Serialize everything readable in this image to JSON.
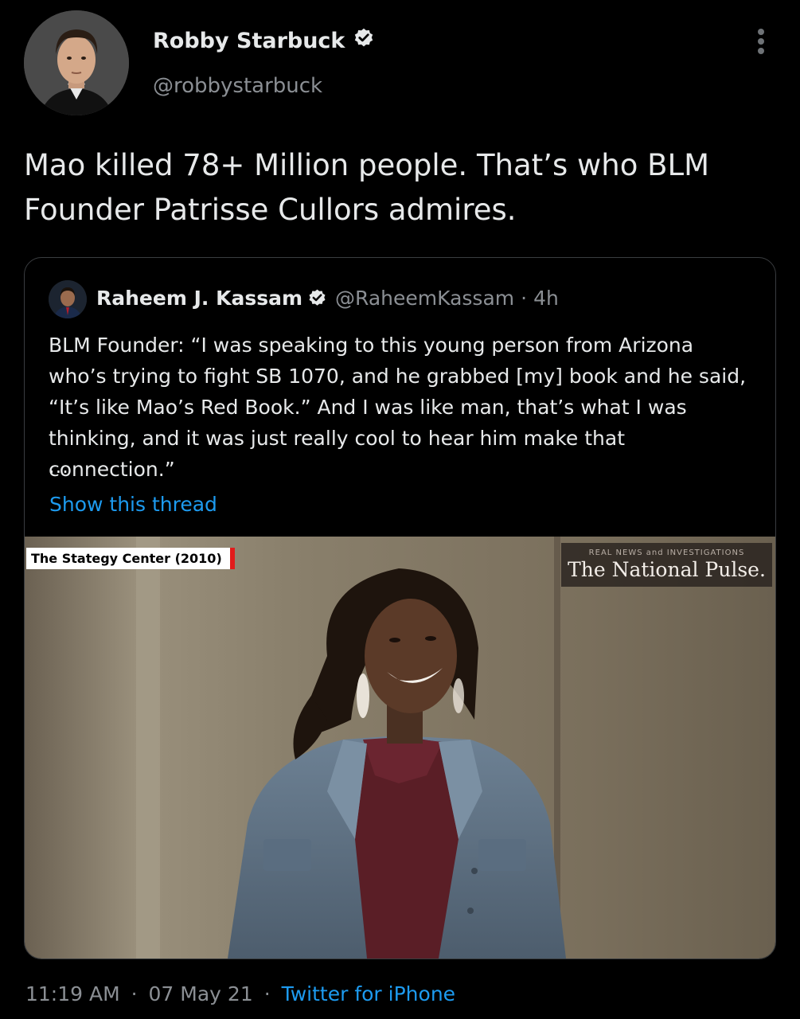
{
  "tweet": {
    "author": {
      "name": "Robby Starbuck",
      "handle": "@robbystarbuck",
      "verified": true
    },
    "text": "Mao killed 78+ Million people. That’s who BLM Founder Patrisse Cullors admires.",
    "timestamp": "11:19 AM",
    "date": "07 May 21",
    "source": "Twitter for iPhone",
    "separator": "·"
  },
  "quote": {
    "author": {
      "name": "Raheem J. Kassam",
      "handle": "@RaheemKassam",
      "verified": true
    },
    "separator": "·",
    "time": "4h",
    "text": "BLM Founder: “I was speaking to this young person from Arizona who’s trying to fight SB 1070, and he grabbed [my] book and he said, “It’s like Mao’s Red Book.” And I was like man, that’s what I was thinking, and it was just really cool to hear him make that connection.”",
    "ellipsis": "...",
    "show_thread": "Show this thread",
    "media": {
      "caption": "The Stategy Center (2010)",
      "logo_kicker": "REAL NEWS and INVESTIGATIONS",
      "logo_title": "The National Pulse."
    }
  },
  "colors": {
    "background": "#000000",
    "text": "#e7e9ea",
    "secondary": "#8b8f94",
    "link": "#1d9bf0",
    "border": "#3a3d40",
    "caption_accent": "#e21b1b"
  },
  "icons": {
    "verified": "verified-badge-icon",
    "more": "more-vertical-icon"
  }
}
